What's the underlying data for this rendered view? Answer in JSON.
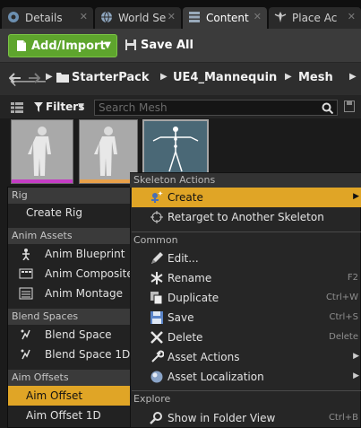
{
  "tabs": [
    {
      "label": "Details",
      "icon": "details-icon"
    },
    {
      "label": "World Se",
      "icon": "world-settings-icon"
    },
    {
      "label": "Content",
      "icon": "content-browser-icon"
    },
    {
      "label": "Place Ac",
      "icon": "place-actors-icon"
    }
  ],
  "toolbar": {
    "add_import_label": "Add/Import",
    "save_all_label": "Save All"
  },
  "breadcrumb": [
    "StarterPack",
    "UE4_Mannequin",
    "Mesh"
  ],
  "filters": {
    "label": "Filters",
    "search_placeholder": "Search Mesh"
  },
  "asset_tiles": [
    {
      "icon": "mannequin-thumbnail",
      "stripe_color": "#c43dc4"
    },
    {
      "icon": "mannequin-thumbnail",
      "stripe_color": "#e8a04a"
    },
    {
      "icon": "skeleton-thumbnail",
      "stripe_color": "#5b87b0"
    }
  ],
  "left_menu": {
    "sections": [
      {
        "title": "Rig",
        "items": [
          {
            "label": "Create Rig",
            "icon": ""
          }
        ]
      },
      {
        "title": "Anim Assets",
        "items": [
          {
            "label": "Anim Blueprint",
            "icon": "anim-blueprint-icon"
          },
          {
            "label": "Anim Composite",
            "icon": "anim-composite-icon"
          },
          {
            "label": "Anim Montage",
            "icon": "anim-montage-icon"
          }
        ]
      },
      {
        "title": "Blend Spaces",
        "items": [
          {
            "label": "Blend Space",
            "icon": "blend-space-icon"
          },
          {
            "label": "Blend Space 1D",
            "icon": "blend-space-1d-icon"
          }
        ]
      },
      {
        "title": "Aim Offsets",
        "items": [
          {
            "label": "Aim Offset",
            "icon": "",
            "highlighted": true
          },
          {
            "label": "Aim Offset 1D",
            "icon": ""
          }
        ]
      }
    ]
  },
  "context_menu": {
    "skeleton_actions": {
      "title": "Skeleton Actions",
      "items": [
        {
          "label": "Create",
          "icon": "create-icon",
          "submenu": true,
          "highlighted": true
        },
        {
          "label": "Retarget to Another Skeleton",
          "icon": "retarget-icon"
        }
      ]
    },
    "common": {
      "title": "Common",
      "items": [
        {
          "label": "Edit...",
          "icon": "edit-icon"
        },
        {
          "label": "Rename",
          "icon": "rename-icon",
          "shortcut": "F2"
        },
        {
          "label": "Duplicate",
          "icon": "duplicate-icon",
          "shortcut": "Ctrl+W"
        },
        {
          "label": "Save",
          "icon": "save-icon",
          "shortcut": "Ctrl+S"
        },
        {
          "label": "Delete",
          "icon": "delete-icon",
          "shortcut": "Delete"
        },
        {
          "label": "Asset Actions",
          "icon": "asset-actions-icon",
          "submenu": true
        },
        {
          "label": "Asset Localization",
          "icon": "asset-localization-icon",
          "submenu": true
        }
      ]
    },
    "explore": {
      "title": "Explore",
      "items": [
        {
          "label": "Show in Folder View",
          "icon": "show-in-folder-icon",
          "shortcut": "Ctrl+B"
        }
      ]
    }
  },
  "colors": {
    "accent_green": "#5ea52d",
    "highlight_orange": "#e0a526",
    "panel_dark": "#262626"
  }
}
